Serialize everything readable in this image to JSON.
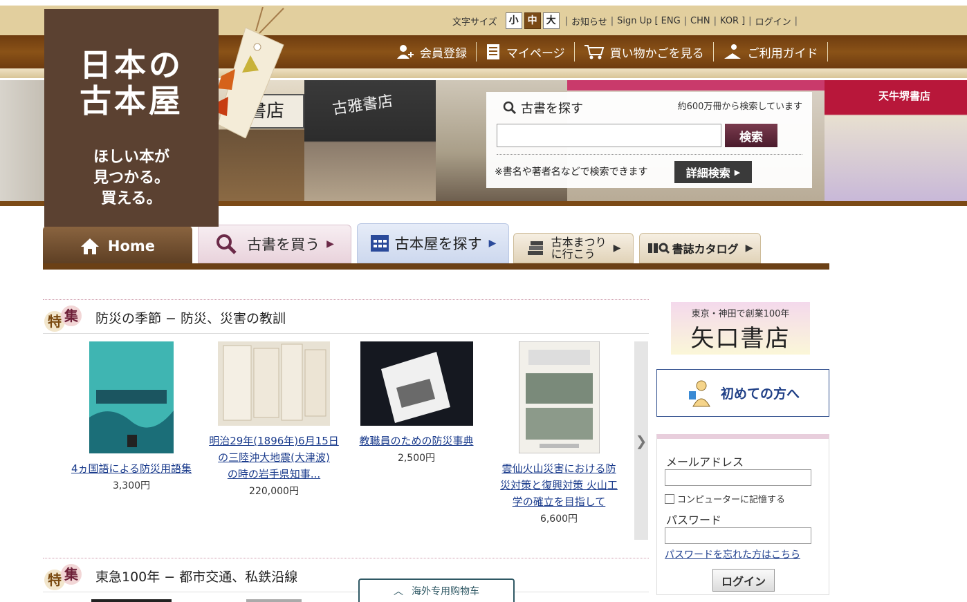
{
  "utility": {
    "font_size_label": "文字サイズ",
    "font_sizes": [
      "小",
      "中",
      "大"
    ],
    "links": [
      "お知らせ",
      "Sign Up [",
      "ENG",
      "CHN",
      "KOR",
      "]",
      "ログイン"
    ]
  },
  "mainnav": {
    "items": [
      "会員登録",
      "マイページ",
      "買い物かごを見る",
      "ご利用ガイド"
    ]
  },
  "logo": {
    "line1": "日本の",
    "line2": "古本屋",
    "tagline1": "ほしい本が",
    "tagline2": "見つかる。",
    "tagline3": "買える。"
  },
  "hero": {
    "sign_left": "書店",
    "sign_mid": "古雅書店",
    "sign_right": "天牛堺書店"
  },
  "search": {
    "title": "古書を探す",
    "count": "約600万冊から検索しています",
    "placeholder": "",
    "button": "検索",
    "note": "※書名や著者名などで検索できます",
    "advanced": "詳細検索"
  },
  "tabs": {
    "home": "Home",
    "buy": "古書を買う",
    "shop": "古本屋を探す",
    "festival_l1": "古本まつり",
    "festival_l2": "に行こう",
    "catalog": "書誌カタログ"
  },
  "features": [
    {
      "badge1": "特",
      "badge2": "集",
      "title": "防災の季節 − 防災、災害の教訓",
      "products": [
        {
          "title_lines": [
            "4ヵ国語による防災用語集"
          ],
          "price": "3,300円"
        },
        {
          "title_lines": [
            "明治29年(1896年)6月15日",
            "の三陸沖大地震(大津波)",
            "の時の岩手県知事..."
          ],
          "price": "220,000円"
        },
        {
          "title_lines": [
            "教職員のための防災事典"
          ],
          "price": "2,500円"
        },
        {
          "title_lines": [
            "雲仙火山災害における防",
            "災対策と復興対策 火山工",
            "学の確立を目指して"
          ],
          "price": "6,600円"
        }
      ]
    },
    {
      "badge1": "特",
      "badge2": "集",
      "title": "東急100年 − 都市交通、私鉄沿線"
    }
  ],
  "sidebar": {
    "banner_line1": "東京・神田で創業100年",
    "banner_line2": "矢口書店",
    "first_time": "初めての方へ",
    "login": {
      "email_label": "メールアドレス",
      "remember": "コンピューターに記憶する",
      "password_label": "パスワード",
      "forgot": "パスワードを忘れた方はこちら",
      "button": "ログイン"
    }
  },
  "overseas": {
    "label": "海外专用购物车"
  },
  "colors": {
    "brown_bar": "#8a5217",
    "tan_bar": "#e2cf9e",
    "logo_bg": "#5b4131",
    "link_blue": "#1a3b8c"
  }
}
